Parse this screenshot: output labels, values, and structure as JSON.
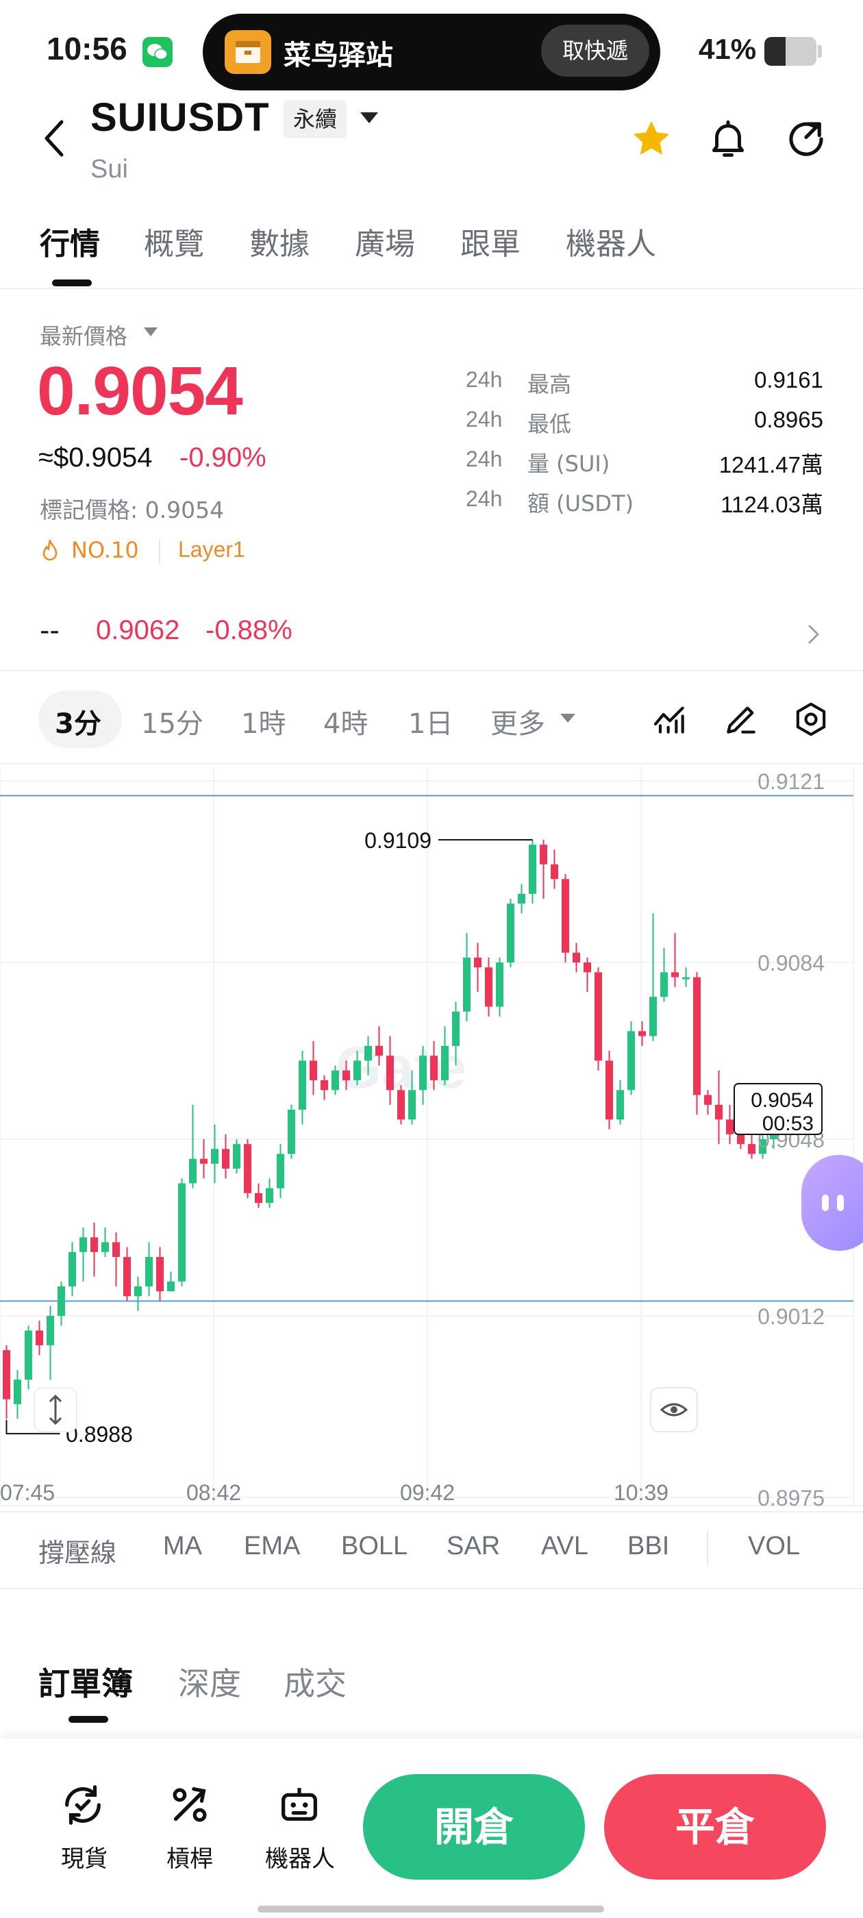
{
  "status": {
    "time": "10:56",
    "island_app": "菜鸟驿站",
    "island_button": "取快遞",
    "battery": "41%",
    "battery_level": 0.41
  },
  "header": {
    "pair": "SUIUSDT",
    "contract_type": "永續",
    "subtitle": "Sui"
  },
  "tabs": [
    "行情",
    "概覽",
    "數據",
    "廣場",
    "跟單",
    "機器人"
  ],
  "price": {
    "latest_label": "最新價格",
    "last": "0.9054",
    "usd": "≈$0.9054",
    "change": "-0.90%",
    "mark": "標記價格: 0.9054",
    "rank": "NO.10",
    "category": "Layer1"
  },
  "stats": [
    {
      "period": "24h",
      "label": "最高",
      "value": "0.9161"
    },
    {
      "period": "24h",
      "label": "最低",
      "value": "0.8965"
    },
    {
      "period": "24h",
      "label": "量 (SUI)",
      "value": "1241.47萬"
    },
    {
      "period": "24h",
      "label": "額 (USDT)",
      "value": "1124.03萬"
    }
  ],
  "spot": {
    "dash": "--",
    "price": "0.9062",
    "change": "-0.88%"
  },
  "timeframes": [
    "3分",
    "15分",
    "1時",
    "4時",
    "1日",
    "更多"
  ],
  "indicators": [
    "撐壓線",
    "MA",
    "EMA",
    "BOLL",
    "SAR",
    "AVL",
    "BBI",
    "VOL"
  ],
  "orderbook_tabs": [
    "訂單簿",
    "深度",
    "成交"
  ],
  "bottom_nav": [
    "現貨",
    "槓桿",
    "機器人"
  ],
  "actions": {
    "open": "開倉",
    "close": "平倉"
  },
  "colors": {
    "up": "#26c281",
    "down": "#ee3557",
    "accent_star": "#f5b700"
  },
  "chart_data": {
    "type": "candlestick",
    "x_ticks": [
      "07:45",
      "08:42",
      "09:42",
      "10:39"
    ],
    "y_ticks": [
      0.9121,
      0.9084,
      0.9048,
      0.9012,
      0.8975
    ],
    "y_tick_labels": [
      "0.9121",
      "0.9084",
      "0.9048",
      "0.9012",
      "0.8975"
    ],
    "ylim": [
      0.8975,
      0.9121
    ],
    "high_annotation": "0.9109",
    "low_annotation": "0.8988",
    "current_price_label": "0.9054",
    "countdown": "00:53",
    "watermark": "Gate",
    "support_lines": [
      0.9118,
      0.9015
    ],
    "candles": [
      [
        0.9005,
        0.8995,
        0.9006,
        0.8991
      ],
      [
        0.8994,
        0.8999,
        0.9001,
        0.8991
      ],
      [
        0.8999,
        0.9009,
        0.901,
        0.8997
      ],
      [
        0.9009,
        0.9006,
        0.9011,
        0.9004
      ],
      [
        0.9006,
        0.9012,
        0.9014,
        0.8999
      ],
      [
        0.9012,
        0.9018,
        0.9019,
        0.901
      ],
      [
        0.9018,
        0.9025,
        0.9027,
        0.9016
      ],
      [
        0.9025,
        0.9028,
        0.903,
        0.9019
      ],
      [
        0.9028,
        0.9025,
        0.9031,
        0.902
      ],
      [
        0.9025,
        0.9027,
        0.903,
        0.9024
      ],
      [
        0.9027,
        0.9024,
        0.9029,
        0.9018
      ],
      [
        0.9024,
        0.9016,
        0.9026,
        0.9015
      ],
      [
        0.9016,
        0.9018,
        0.902,
        0.9013
      ],
      [
        0.9018,
        0.9024,
        0.9027,
        0.9016
      ],
      [
        0.9024,
        0.9017,
        0.9026,
        0.9015
      ],
      [
        0.9017,
        0.9019,
        0.9021,
        0.9017
      ],
      [
        0.9019,
        0.9039,
        0.904,
        0.9018
      ],
      [
        0.9039,
        0.9044,
        0.9055,
        0.9038
      ],
      [
        0.9044,
        0.9043,
        0.9048,
        0.904
      ],
      [
        0.9043,
        0.9046,
        0.9051,
        0.9039
      ],
      [
        0.9046,
        0.9042,
        0.9049,
        0.904
      ],
      [
        0.9042,
        0.9047,
        0.9048,
        0.9041
      ],
      [
        0.9047,
        0.9037,
        0.9048,
        0.9036
      ],
      [
        0.9037,
        0.9035,
        0.9039,
        0.9034
      ],
      [
        0.9035,
        0.9038,
        0.904,
        0.9034
      ],
      [
        0.9038,
        0.9045,
        0.9047,
        0.9036
      ],
      [
        0.9045,
        0.9054,
        0.9055,
        0.9044
      ],
      [
        0.9054,
        0.9064,
        0.9066,
        0.9051
      ],
      [
        0.9064,
        0.906,
        0.9068,
        0.9057
      ],
      [
        0.906,
        0.9058,
        0.9061,
        0.9056
      ],
      [
        0.9058,
        0.9062,
        0.9063,
        0.9057
      ],
      [
        0.9062,
        0.906,
        0.9064,
        0.9058
      ],
      [
        0.906,
        0.9064,
        0.9066,
        0.9059
      ],
      [
        0.9064,
        0.9067,
        0.9069,
        0.9061
      ],
      [
        0.9067,
        0.9065,
        0.9071,
        0.9063
      ],
      [
        0.9065,
        0.9058,
        0.9069,
        0.9055
      ],
      [
        0.9058,
        0.9052,
        0.9059,
        0.9051
      ],
      [
        0.9052,
        0.9058,
        0.9062,
        0.9051
      ],
      [
        0.9058,
        0.9065,
        0.9067,
        0.9055
      ],
      [
        0.9065,
        0.906,
        0.9068,
        0.9058
      ],
      [
        0.906,
        0.9067,
        0.9071,
        0.9059
      ],
      [
        0.9067,
        0.9074,
        0.9076,
        0.9063
      ],
      [
        0.9074,
        0.9085,
        0.909,
        0.9072
      ],
      [
        0.9085,
        0.9083,
        0.9088,
        0.9078
      ],
      [
        0.9083,
        0.9075,
        0.9085,
        0.9073
      ],
      [
        0.9075,
        0.9084,
        0.9085,
        0.9073
      ],
      [
        0.9084,
        0.9096,
        0.9097,
        0.9083
      ],
      [
        0.9096,
        0.9098,
        0.91,
        0.9094
      ],
      [
        0.9098,
        0.9108,
        0.9109,
        0.9096
      ],
      [
        0.9108,
        0.9104,
        0.9109,
        0.9097
      ],
      [
        0.9104,
        0.9101,
        0.9107,
        0.9099
      ],
      [
        0.9101,
        0.9086,
        0.9102,
        0.9084
      ],
      [
        0.9086,
        0.9084,
        0.9088,
        0.9082
      ],
      [
        0.9084,
        0.9082,
        0.9085,
        0.9078
      ],
      [
        0.9082,
        0.9064,
        0.9083,
        0.9062
      ],
      [
        0.9064,
        0.9052,
        0.9066,
        0.905
      ],
      [
        0.9052,
        0.9058,
        0.906,
        0.9051
      ],
      [
        0.9058,
        0.907,
        0.9072,
        0.9057
      ],
      [
        0.907,
        0.9069,
        0.9072,
        0.9067
      ],
      [
        0.9069,
        0.9077,
        0.9094,
        0.9068
      ],
      [
        0.9077,
        0.9082,
        0.9087,
        0.9076
      ],
      [
        0.9082,
        0.9081,
        0.909,
        0.9079
      ],
      [
        0.9081,
        0.9081,
        0.9083,
        0.9079
      ],
      [
        0.9081,
        0.9057,
        0.9082,
        0.9053
      ],
      [
        0.9057,
        0.9055,
        0.9058,
        0.9053
      ],
      [
        0.9055,
        0.9052,
        0.9062,
        0.9047
      ],
      [
        0.9052,
        0.9049,
        0.9055,
        0.9047
      ],
      [
        0.9049,
        0.9047,
        0.9059,
        0.9046
      ],
      [
        0.9047,
        0.9045,
        0.905,
        0.9044
      ],
      [
        0.9045,
        0.9048,
        0.9052,
        0.9044
      ],
      [
        0.9048,
        0.9054,
        0.9055,
        0.9046
      ]
    ]
  }
}
